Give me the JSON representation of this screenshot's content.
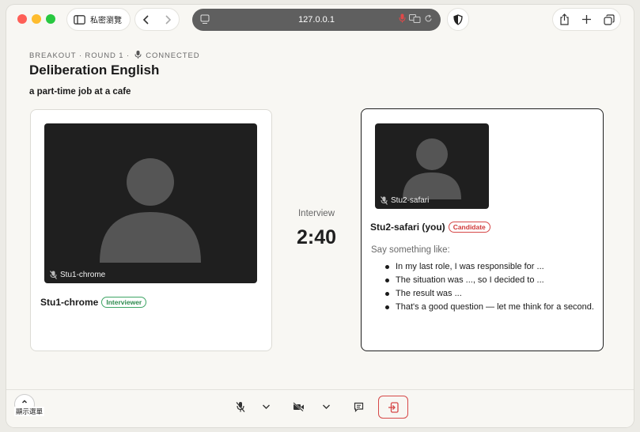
{
  "browser": {
    "private_label": "私密瀏覽",
    "url": "127.0.0.1"
  },
  "header": {
    "kicker_prefix": "BREAKOUT · ROUND 1 ·",
    "status": "CONNECTED",
    "title": "Deliberation English",
    "topic": "a part-time job at a cafe"
  },
  "timer": {
    "label": "Interview",
    "value": "2:40"
  },
  "participants": {
    "left": {
      "video_label": "Stu1-chrome",
      "name": "Stu1-chrome",
      "role": "Interviewer"
    },
    "right": {
      "video_label": "Stu2-safari",
      "name": "Stu2-safari (you)",
      "role": "Candidate",
      "hint_intro": "Say something like:",
      "hints": [
        "In my last role, I was responsible for ...",
        "The situation was ..., so I decided to ...",
        "The result was ...",
        "That's a good question — let me think for a second."
      ]
    }
  },
  "menu": {
    "label": "顯示選單"
  },
  "colors": {
    "interviewer_badge": "#3ea565",
    "candidate_badge": "#d64848",
    "leave_button": "#d64848",
    "address_bar": "#5f5f5f"
  },
  "icons": {
    "mic_muted": "mic-off-icon",
    "camera_off": "camera-off-icon",
    "chat": "chat-icon",
    "leave": "exit-icon"
  }
}
